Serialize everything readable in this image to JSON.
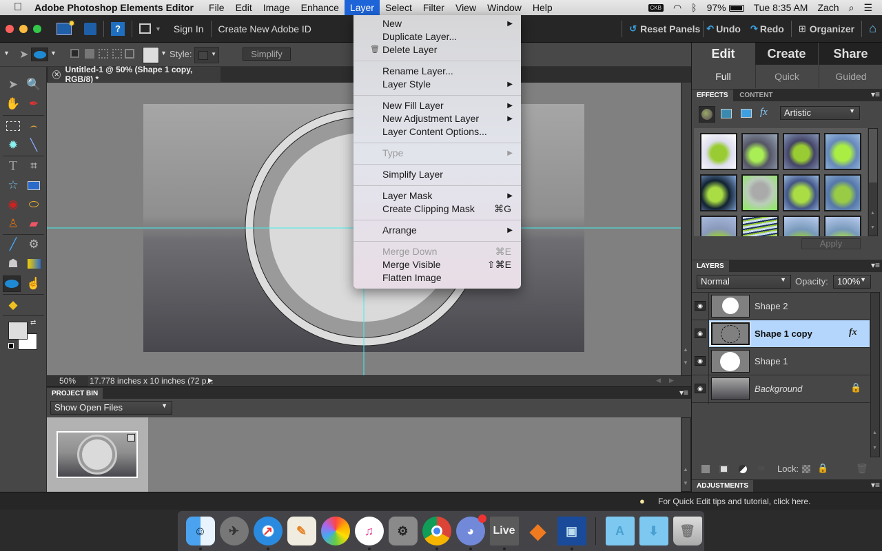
{
  "menubar": {
    "apple": "",
    "app_name": "Adobe Photoshop Elements Editor",
    "menus": [
      "File",
      "Edit",
      "Image",
      "Enhance",
      "Layer",
      "Select",
      "Filter",
      "View",
      "Window",
      "Help"
    ],
    "active_menu": "Layer",
    "status": {
      "keyboard": "CKB",
      "battery": "97%",
      "clock": "Tue 8:35 AM",
      "user": "Zach"
    }
  },
  "app_toolbar": {
    "sign_in": "Sign In",
    "create_id": "Create New Adobe ID",
    "reset_panels": "Reset Panels",
    "undo": "Undo",
    "redo": "Redo",
    "organizer": "Organizer"
  },
  "options_bar": {
    "style_label": "Style:",
    "simplify_label": "Simplify"
  },
  "document": {
    "tab_title": "Untitled-1 @ 50% (Shape 1 copy, RGB/8) *",
    "zoom": "50%",
    "doc_info": "17.778 inches x 10 inches (72 p..."
  },
  "project_bin": {
    "title": "PROJECT BIN",
    "filter": "Show Open Files"
  },
  "layer_menu": {
    "groups": [
      [
        {
          "label": "New",
          "submenu": true
        },
        {
          "label": "Duplicate Layer..."
        },
        {
          "label": "Delete Layer",
          "icon": "trash"
        }
      ],
      [
        {
          "label": "Rename Layer..."
        },
        {
          "label": "Layer Style",
          "submenu": true
        }
      ],
      [
        {
          "label": "New Fill Layer",
          "submenu": true
        },
        {
          "label": "New Adjustment Layer",
          "submenu": true
        },
        {
          "label": "Layer Content Options..."
        }
      ],
      [
        {
          "label": "Type",
          "submenu": true,
          "disabled": true
        }
      ],
      [
        {
          "label": "Simplify Layer"
        }
      ],
      [
        {
          "label": "Layer Mask",
          "submenu": true
        },
        {
          "label": "Create Clipping Mask",
          "shortcut": "⌘G"
        }
      ],
      [
        {
          "label": "Arrange",
          "submenu": true
        }
      ],
      [
        {
          "label": "Merge Down",
          "shortcut": "⌘E",
          "disabled": true
        },
        {
          "label": "Merge Visible",
          "shortcut": "⇧⌘E"
        },
        {
          "label": "Flatten Image"
        }
      ]
    ]
  },
  "right_panel": {
    "mode_tabs": [
      "Edit",
      "Create",
      "Share"
    ],
    "active_mode": "Edit",
    "sub_tabs": [
      "Full",
      "Quick",
      "Guided"
    ],
    "active_sub": "Full",
    "effects": {
      "tabs": [
        "EFFECTS",
        "CONTENT"
      ],
      "category": "Artistic",
      "apply_label": "Apply"
    },
    "layers": {
      "title": "LAYERS",
      "blend_mode": "Normal",
      "opacity_label": "Opacity:",
      "opacity": "100%",
      "items": [
        {
          "name": "Shape 2",
          "selected": false,
          "fx": false,
          "locked": false
        },
        {
          "name": "Shape 1 copy",
          "selected": true,
          "fx": true,
          "locked": false
        },
        {
          "name": "Shape 1",
          "selected": false,
          "fx": false,
          "locked": false
        },
        {
          "name": "Background",
          "selected": false,
          "fx": false,
          "locked": true
        }
      ],
      "lock_label": "Lock:"
    },
    "adjustments_title": "ADJUSTMENTS"
  },
  "tips": "For Quick Edit tips and tutorial, click here.",
  "dock": [
    "Finder",
    "Launchpad",
    "Safari",
    "Pages",
    "Photos",
    "iTunes",
    "System Preferences",
    "Chrome",
    "Discord",
    "Live",
    "FL Studio",
    "Photoshop Elements",
    "Applications",
    "Downloads",
    "Trash"
  ]
}
